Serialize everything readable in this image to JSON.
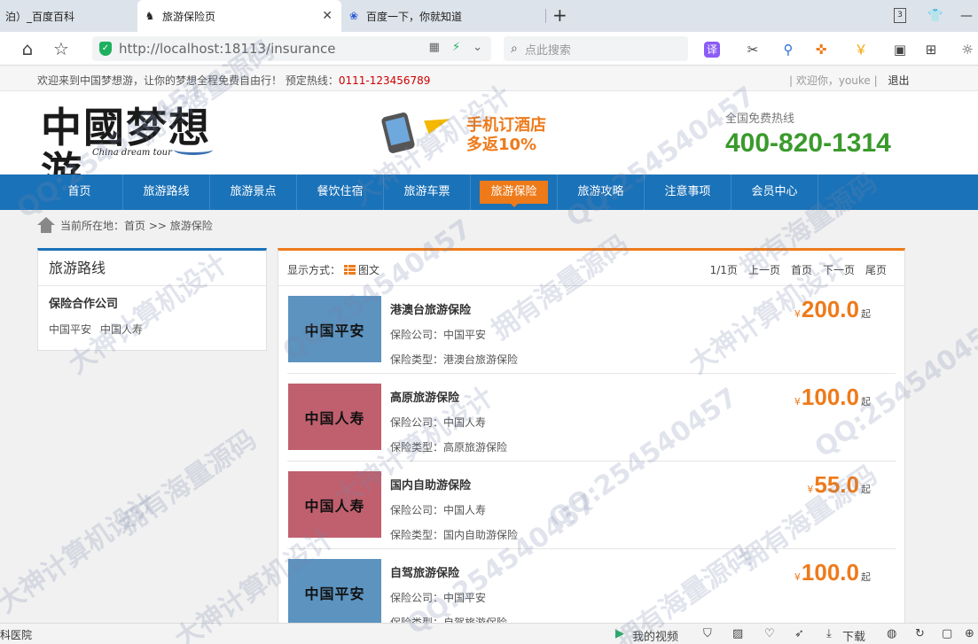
{
  "browser": {
    "tabs": [
      {
        "label": "泊）_百度百科",
        "active": false
      },
      {
        "label": "旅游保险页",
        "active": true
      },
      {
        "label": "百度一下，你就知道",
        "active": false
      }
    ],
    "tab_count_badge": "3",
    "url": "http://localhost:18113/insurance",
    "search_placeholder": "点此搜索",
    "translate_label": "译"
  },
  "topbar": {
    "welcome": "欢迎来到中国梦想游，让你的梦想全程免费自由行！ 预定热线：",
    "hotline": "0111-123456789",
    "user_greeting": "| 欢迎你，youke |",
    "logout": "退出"
  },
  "header": {
    "logo_cn": "中國梦想游",
    "logo_en": "China dream tour",
    "promo_line1": "手机订酒店",
    "promo_line2": "多返10%",
    "hotline_label": "全国免费热线",
    "hotline_number": "400-820-1314"
  },
  "nav": {
    "items": [
      "首页",
      "旅游路线",
      "旅游景点",
      "餐饮住宿",
      "旅游车票",
      "旅游保险",
      "旅游攻略",
      "注意事项",
      "会员中心"
    ],
    "active_index": 5
  },
  "breadcrumb": "当前所在地：首页 >> 旅游保险",
  "sidebar": {
    "title": "旅游路线",
    "subtitle": "保险合作公司",
    "companies": [
      "中国平安",
      "中国人寿"
    ]
  },
  "list": {
    "display_label": "显示方式：",
    "display_mode": "图文",
    "pager": {
      "page": "1/1页",
      "prev": "上一页",
      "first": "首页",
      "next": "下一页",
      "last": "尾页"
    },
    "company_prefix": "保险公司：",
    "type_prefix": "保险类型：",
    "currency": "¥",
    "price_suffix": "起",
    "items": [
      {
        "name": "港澳台旅游保险",
        "company": "中国平安",
        "type": "港澳台旅游保险",
        "price": "200.0",
        "thumb": "中国平安",
        "color": "#5c93bf"
      },
      {
        "name": "高原旅游保险",
        "company": "中国人寿",
        "type": "高原旅游保险",
        "price": "100.0",
        "thumb": "中国人寿",
        "color": "#c0606e"
      },
      {
        "name": "国内自助游保险",
        "company": "中国人寿",
        "type": "国内自助游保险",
        "price": "55.0",
        "thumb": "中国人寿",
        "color": "#c0606e"
      },
      {
        "name": "自驾旅游保险",
        "company": "中国平安",
        "type": "自驾旅游保险",
        "price": "100.0",
        "thumb": "中国平安",
        "color": "#5c93bf"
      }
    ]
  },
  "statusbar": {
    "left": "科医院",
    "video": "我的视频",
    "download": "下载"
  },
  "watermark": [
    "QQ:254540457",
    "拥有海量源码",
    "大神计算机设计"
  ],
  "colors": {
    "nav_blue": "#1a72b8",
    "accent_orange": "#ee7a1a",
    "hotline_green": "#3a9a2c"
  }
}
